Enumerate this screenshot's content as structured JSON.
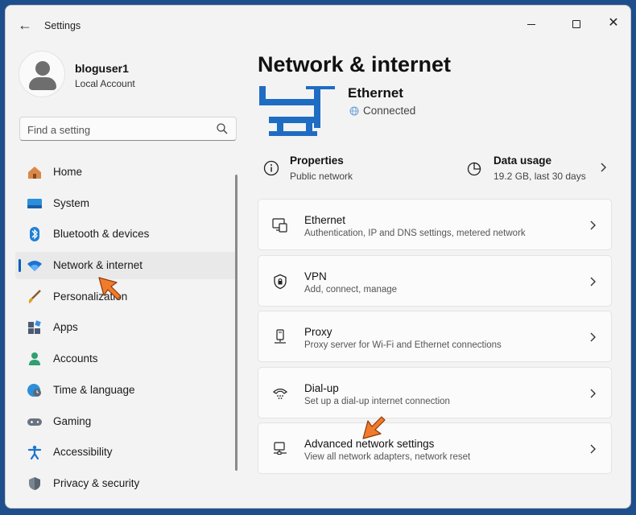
{
  "window": {
    "title": "Settings",
    "back_label": "←",
    "controls": {
      "close_label": "✕"
    }
  },
  "profile": {
    "name": "bloguser1",
    "account_type": "Local Account"
  },
  "search": {
    "placeholder": "Find a setting",
    "value": ""
  },
  "nav": {
    "items": [
      {
        "label": "Home",
        "icon": "home-icon",
        "active": false
      },
      {
        "label": "System",
        "icon": "system-icon",
        "active": false
      },
      {
        "label": "Bluetooth & devices",
        "icon": "bluetooth-icon",
        "active": false
      },
      {
        "label": "Network & internet",
        "icon": "wifi-icon",
        "active": true
      },
      {
        "label": "Personalization",
        "icon": "brush-icon",
        "active": false
      },
      {
        "label": "Apps",
        "icon": "apps-icon",
        "active": false
      },
      {
        "label": "Accounts",
        "icon": "accounts-icon",
        "active": false
      },
      {
        "label": "Time & language",
        "icon": "clock-globe-icon",
        "active": false
      },
      {
        "label": "Gaming",
        "icon": "gamepad-icon",
        "active": false
      },
      {
        "label": "Accessibility",
        "icon": "accessibility-icon",
        "active": false
      },
      {
        "label": "Privacy & security",
        "icon": "shield-icon",
        "active": false
      }
    ]
  },
  "main": {
    "title": "Network & internet",
    "connection": {
      "name": "Ethernet",
      "status": "Connected"
    },
    "properties": {
      "title": "Properties",
      "subtitle": "Public network"
    },
    "data_usage": {
      "title": "Data usage",
      "subtitle": "19.2 GB, last 30 days"
    },
    "cards": [
      {
        "title": "Ethernet",
        "subtitle": "Authentication, IP and DNS settings, metered network",
        "icon": "ethernet-icon"
      },
      {
        "title": "VPN",
        "subtitle": "Add, connect, manage",
        "icon": "vpn-shield-icon"
      },
      {
        "title": "Proxy",
        "subtitle": "Proxy server for Wi-Fi and Ethernet connections",
        "icon": "proxy-icon"
      },
      {
        "title": "Dial-up",
        "subtitle": "Set up a dial-up internet connection",
        "icon": "dialup-icon"
      },
      {
        "title": "Advanced network settings",
        "subtitle": "View all network adapters, network reset",
        "icon": "advanced-network-icon"
      }
    ]
  },
  "colors": {
    "accent": "#005fb8",
    "hero_icon": "#1f6cc3",
    "annotation_arrow": "#f07b2a",
    "background": "#f3f3f3"
  }
}
